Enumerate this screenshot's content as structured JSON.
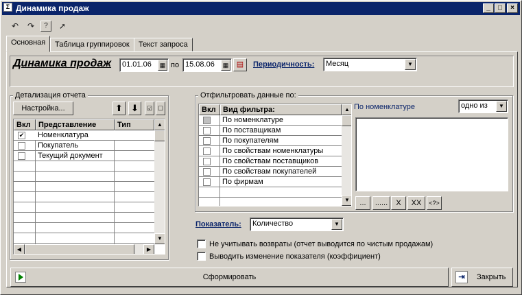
{
  "window": {
    "title": "Динамика продаж"
  },
  "toolbar": [
    {
      "name": "undo-icon",
      "glyph": "↶"
    },
    {
      "name": "redo-icon",
      "glyph": "↷"
    },
    {
      "name": "help-icon",
      "glyph": "?"
    },
    {
      "name": "pointer-help-icon",
      "glyph": "➚"
    }
  ],
  "tabs": [
    "Основная",
    "Таблица группировок",
    "Текст запроса"
  ],
  "header": {
    "report_title": "Динамика продаж",
    "date_from": "01.01.06",
    "between_label": "по",
    "date_to": "15.08.06",
    "periodicity_label": "Периодичность:",
    "periodicity_value": "Месяц"
  },
  "detail": {
    "group_title": "Детализация отчета",
    "settings_button": "Настройка...",
    "columns": [
      "Вкл",
      "Представление",
      "Тип"
    ],
    "rows": [
      {
        "checked": true,
        "label": "Номенклатура",
        "type": ""
      },
      {
        "checked": false,
        "label": "Покупатель",
        "type": ""
      },
      {
        "checked": false,
        "label": "Текущий документ",
        "type": ""
      }
    ]
  },
  "filter": {
    "group_title": "Отфильтровать данные по:",
    "columns": [
      "Вкл",
      "Вид фильтра:"
    ],
    "rows": [
      "По номенклатуре",
      "По поставщикам",
      "По покупателям",
      "По свойствам номенклатуры",
      "По свойствам поставщиков",
      "По свойствам покупателей",
      "По фирмам"
    ],
    "selected_label": "По номенклатуре",
    "condition_value": "одно из",
    "buttons": [
      "...",
      "......",
      "X",
      "XX",
      "<?>"
    ]
  },
  "indicator": {
    "label": "Показатель:",
    "value": "Количество"
  },
  "options": [
    "Не учитывать возвраты (отчет выводится по чистым продажам)",
    "Выводить изменение показателя (коэффициент)"
  ],
  "actions": {
    "run_label": "Сформировать",
    "close_label": "Закрыть"
  }
}
